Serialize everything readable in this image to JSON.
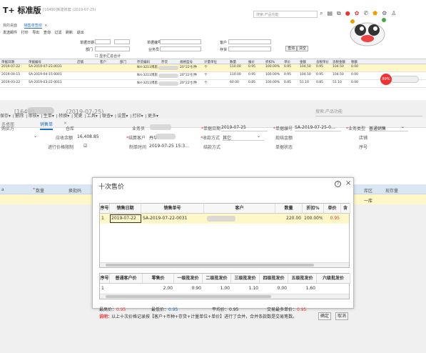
{
  "top": {
    "logo": "T+ 标准版",
    "logo_sub": "[16490]新建账套 (2019-07-25)",
    "search_placeholder": "搜索:产品功能",
    "icons": [
      "search-icon",
      "clipboard-icon",
      "copy-icon",
      "notification-icon",
      "gift-icon",
      "phone-icon",
      "badge-icon",
      "settings-icon",
      "user-icon",
      "more-icon"
    ],
    "tabs": [
      "我的桌面",
      "销售单查询",
      "×"
    ],
    "menu": [
      "发送邮件",
      "打印",
      "导出",
      "查询",
      "过滤",
      "刷新",
      "退出"
    ],
    "filters": {
      "date_label": "单据日期",
      "dept_label": "部门",
      "docno_label": "单据编号",
      "biz_label": "业务员",
      "cust_label": "客户",
      "stock_label": "存货",
      "query_btn": "查询",
      "clear_btn": "清空",
      "check_label": "显示汇总合计"
    },
    "grid_headers": [
      "单据日期",
      "单据编号",
      "店铺",
      "客户",
      "部门",
      "存货编码",
      "存货",
      "规格型号",
      "计量单位",
      "数量",
      "报价",
      "折扣%",
      "单价",
      "金额",
      "含税单价",
      "含税金额",
      "税额"
    ],
    "grid_rows": [
      [
        "2019-07-22",
        "SA-2019-07-22-0031",
        "",
        "",
        "",
        "NH-3211博思",
        "",
        "20°22寸/件",
        "个",
        "110.00",
        "0.95",
        "100.00%",
        "0.95",
        "104.50",
        "0.95",
        "104.50",
        "0.00"
      ],
      [
        "2019-04-15",
        "SA-2019-04-15-0001",
        "",
        "",
        "",
        "NH-3211博思",
        "",
        "20°22寸/件",
        "个",
        "110.00",
        "0.95",
        "100.00%",
        "0.95",
        "104.50",
        "0.95",
        "104.50",
        "0.00"
      ],
      [
        "2019-03-22",
        "SA-2019-03-22-0011",
        "",
        "",
        "",
        "NH-3211博思",
        "",
        "20°22寸/件",
        "个",
        "60.00",
        "0.85",
        "100.00%",
        "0.85",
        "51.10",
        "0.85",
        "51.10",
        "0.00"
      ]
    ],
    "badge_text": "89%"
  },
  "bottom": {
    "window_title": "[16490",
    "window_date": "(2019-07-25)",
    "search_placeholder": "搜索:产品功能",
    "tabs": [
      "务桌面",
      "销售单",
      "×"
    ],
    "toolbar": [
      "保存▾",
      "删除",
      "审核▾",
      "生单▾",
      "转换▾",
      "变更",
      "工具▾",
      "联查▾",
      "设置▾",
      "打印▾",
      "更多▾"
    ],
    "form": {
      "row1": [
        {
          "label": "购买方",
          "value": ""
        },
        {
          "label": "仓库",
          "value": ""
        },
        {
          "label": "业务员",
          "value": ""
        },
        {
          "label": "单据日期",
          "value": "2019-07-25",
          "req": true
        },
        {
          "label": "单据编号",
          "value": "SA-2019-07-25-0...",
          "req": true
        },
        {
          "label": "业务类型",
          "value": "普通销售",
          "req": true
        }
      ],
      "row2": [
        {
          "label": "应收余额",
          "value": "16,408.85"
        },
        {
          "label": "结算客户",
          "value": "丹华",
          "req": true
        },
        {
          "label": "收款方式",
          "value": "其它",
          "req": true
        },
        {
          "label": "现结金额",
          "value": ""
        },
        {
          "label": "店铺",
          "value": ""
        }
      ],
      "row3": [
        {
          "label": "进行价格限制",
          "value": "☑"
        },
        {
          "label": "制单时间",
          "value": "2019-07-25 15:3..."
        },
        {
          "label": "结款方式",
          "value": ""
        },
        {
          "label": "单据状态",
          "value": ""
        },
        {
          "label": "序号",
          "value": ""
        }
      ]
    },
    "grid_headers": [
      "数量",
      "换批码",
      "库区",
      "现存量"
    ],
    "grid_row_value": "一库"
  },
  "dialog": {
    "title": "十次售价",
    "help": "?",
    "close": "×",
    "table1_headers": [
      "序号",
      "销售日期",
      "销售单号",
      "客户",
      "数量",
      "折扣%",
      "单价",
      "含"
    ],
    "table1_row": [
      "1",
      "2019-07-22",
      "SA-2019-07-22-0031",
      "",
      "220.00",
      "100.00%",
      "0.95",
      ""
    ],
    "table2_headers": [
      "序号",
      "普通客户价",
      "零售价",
      "一级批发价",
      "二级批发价",
      "三级批发价",
      "四级批发价",
      "五级批发价",
      "六级批发价"
    ],
    "table2_row": [
      "1",
      "",
      "2.00",
      "0.90",
      "1.00",
      "1.10",
      "0.00",
      "1.60",
      ""
    ],
    "stats": {
      "max_label": "最高价：",
      "max_value": "0.95",
      "min_label": "最低价：",
      "min_value": "0.95",
      "avg_label": "平均价：",
      "avg_value": "0.95",
      "mode_label": "交易最多单价：",
      "mode_value": "0.95"
    },
    "note_label": "说明：",
    "note_text": "以上十次价格记录按【客户+币种+存货+计量单位+单价】进行了合并，合并条款数是交易笔数。",
    "ok": "确定",
    "cancel": "取消"
  },
  "colors": {
    "accent": "#1f6fc5",
    "selected_row": "#fff7c8",
    "required": "#e33333",
    "grid_header": "#dbe6f3"
  }
}
